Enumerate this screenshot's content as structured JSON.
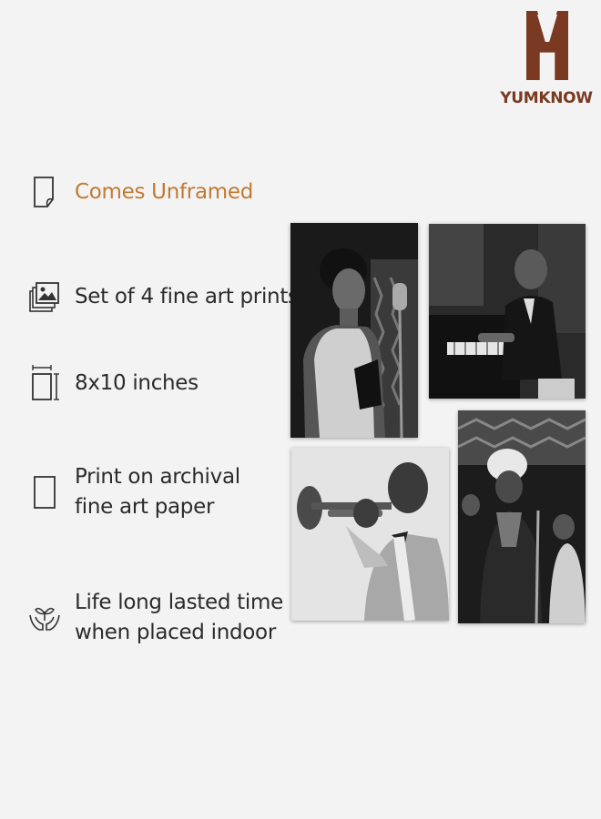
{
  "brand": {
    "name": "YUMKNOW",
    "color": "#7a3a22"
  },
  "features": [
    {
      "icon": "folded-page-icon",
      "text": "Comes Unframed",
      "color": "#c07a35"
    },
    {
      "icon": "stacked-photos-icon",
      "text": "Set of 4 fine art prints",
      "color": "#2b2b2b"
    },
    {
      "icon": "frame-size-icon",
      "text": "8x10 inches",
      "color": "#2b2b2b"
    },
    {
      "icon": "paper-sheet-icon",
      "text": "Print on archival\nfine art paper",
      "color": "#2b2b2b"
    },
    {
      "icon": "hands-plant-icon",
      "text": "Life long lasted time\nwhen placed indoor",
      "color": "#2b2b2b"
    }
  ],
  "prints": [
    {
      "subject": "singer-with-microphone"
    },
    {
      "subject": "pianist-at-piano"
    },
    {
      "subject": "trumpet-player"
    },
    {
      "subject": "singer-on-stage"
    }
  ]
}
